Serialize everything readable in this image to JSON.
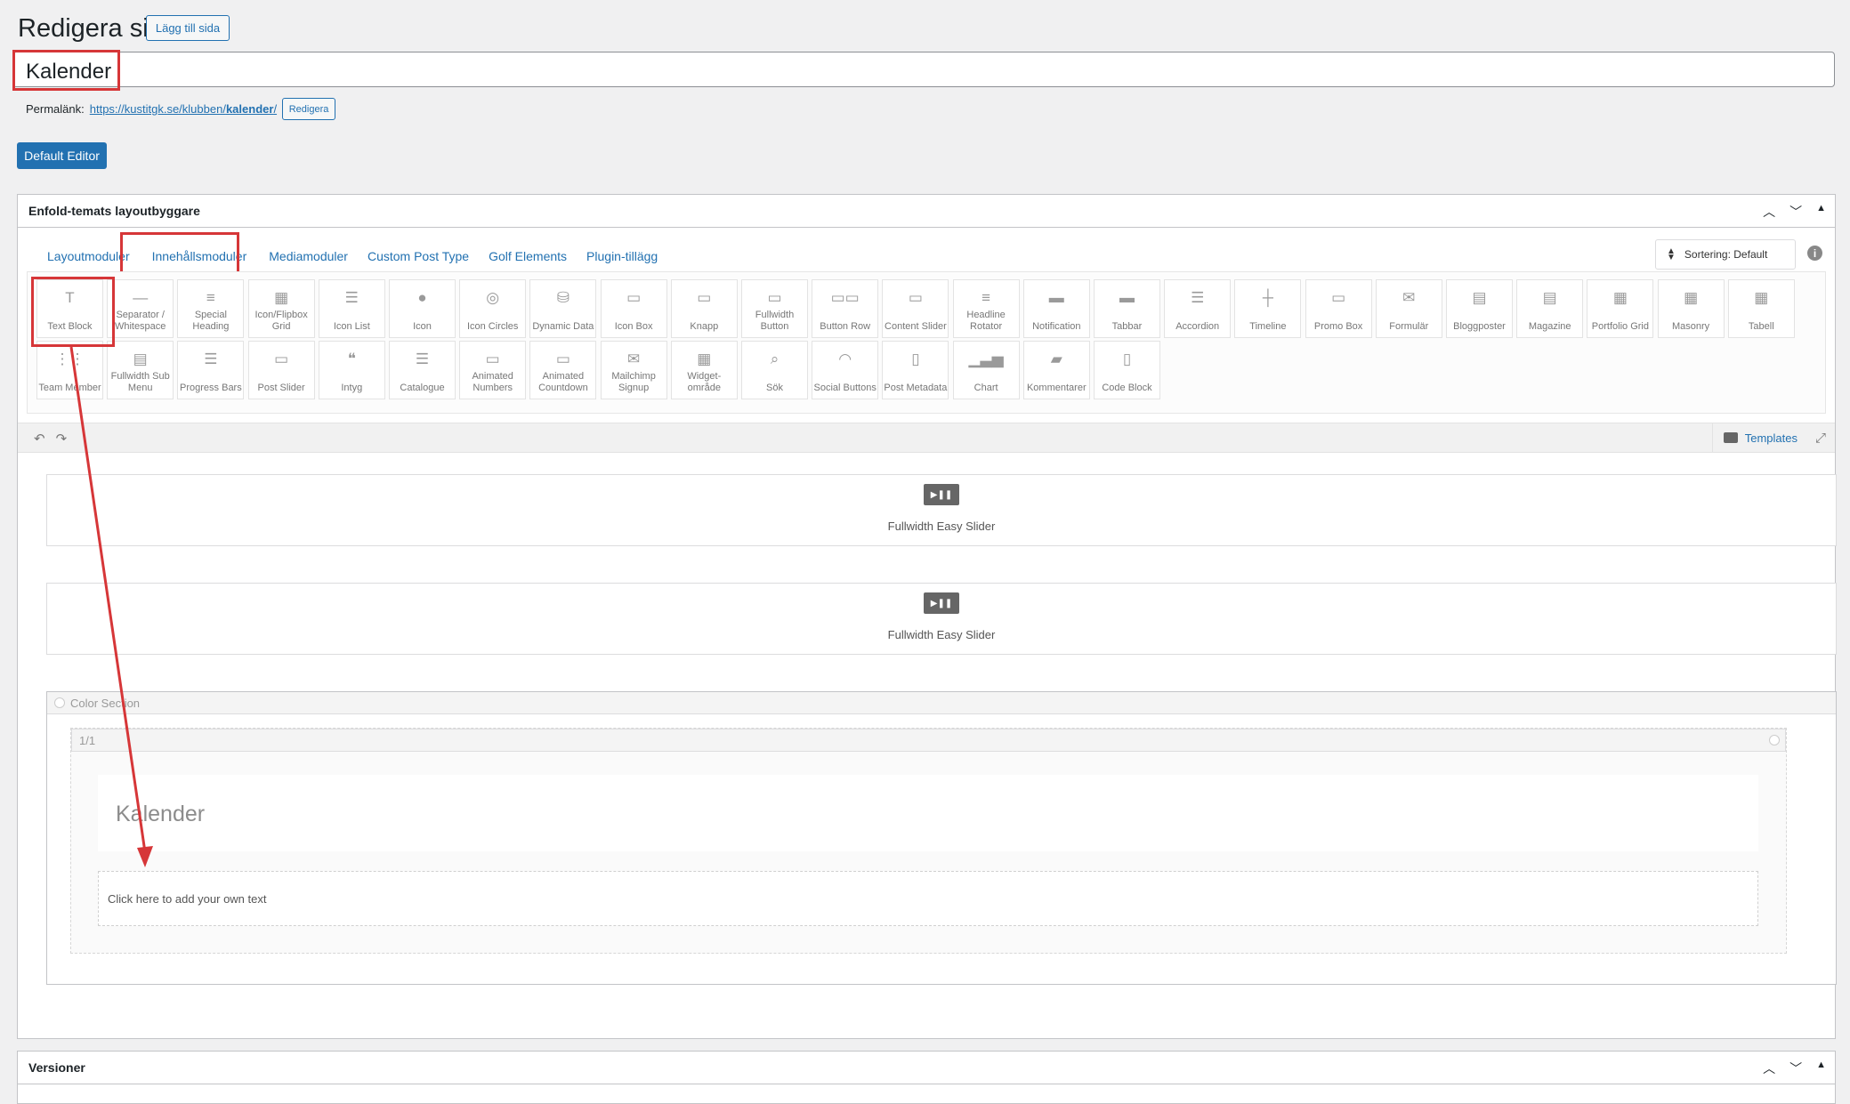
{
  "header": {
    "page_title": "Redigera sida",
    "add_page_button": "Lägg till sida",
    "post_title": "Kalender",
    "permalink_label": "Permalänk:",
    "permalink_base": "https://kustitgk.se/klubben/",
    "permalink_slug": "kalender",
    "permalink_trailing": "/",
    "edit_permalink_button": "Redigera",
    "default_editor_button": "Default Editor"
  },
  "builder": {
    "title": "Enfold-temats layoutbyggare",
    "tabs": [
      {
        "label": "Layoutmoduler"
      },
      {
        "label": "Innehållsmoduler"
      },
      {
        "label": "Mediamoduler"
      },
      {
        "label": "Custom Post Type"
      },
      {
        "label": "Golf Elements"
      },
      {
        "label": "Plugin-tillägg"
      }
    ],
    "sort_label": "Sortering: Default",
    "modules_row1": [
      {
        "label": "Text Block",
        "icon": "text-icon"
      },
      {
        "label": "Separator / Whitespace",
        "icon": "separator-icon"
      },
      {
        "label": "Special Heading",
        "icon": "heading-icon"
      },
      {
        "label": "Icon/Flipbox Grid",
        "icon": "grid-icon"
      },
      {
        "label": "Icon List",
        "icon": "list-icon"
      },
      {
        "label": "Icon",
        "icon": "info-icon"
      },
      {
        "label": "Icon Circles",
        "icon": "circles-icon"
      },
      {
        "label": "Dynamic Data",
        "icon": "database-icon"
      },
      {
        "label": "Icon Box",
        "icon": "box-icon"
      },
      {
        "label": "Knapp",
        "icon": "button-icon"
      },
      {
        "label": "Fullwidth Button",
        "icon": "button-icon"
      },
      {
        "label": "Button Row",
        "icon": "button-row-icon"
      },
      {
        "label": "Content Slider",
        "icon": "slider-icon"
      },
      {
        "label": "Headline Rotator",
        "icon": "rotator-icon"
      },
      {
        "label": "Notification",
        "icon": "notification-icon"
      },
      {
        "label": "Tabbar",
        "icon": "tabs-icon"
      },
      {
        "label": "Accordion",
        "icon": "accordion-icon"
      },
      {
        "label": "Timeline",
        "icon": "timeline-icon"
      },
      {
        "label": "Promo Box",
        "icon": "promo-icon"
      },
      {
        "label": "Formulär",
        "icon": "envelope-icon"
      },
      {
        "label": "Bloggposter",
        "icon": "blog-icon"
      },
      {
        "label": "Magazine",
        "icon": "magazine-icon"
      },
      {
        "label": "Portfolio Grid",
        "icon": "portfolio-icon"
      },
      {
        "label": "Masonry",
        "icon": "masonry-icon"
      },
      {
        "label": "Tabell",
        "icon": "table-icon"
      }
    ],
    "modules_row2": [
      {
        "label": "Team Member",
        "icon": "team-icon"
      },
      {
        "label": "Fullwidth Sub Menu",
        "icon": "menu-icon"
      },
      {
        "label": "Progress Bars",
        "icon": "progress-icon"
      },
      {
        "label": "Post Slider",
        "icon": "post-slider-icon"
      },
      {
        "label": "Intyg",
        "icon": "quote-icon"
      },
      {
        "label": "Catalogue",
        "icon": "catalogue-icon"
      },
      {
        "label": "Animated Numbers",
        "icon": "numbers-icon"
      },
      {
        "label": "Animated Countdown",
        "icon": "countdown-icon"
      },
      {
        "label": "Mailchimp Signup",
        "icon": "mail-icon"
      },
      {
        "label": "Widget-område",
        "icon": "widget-icon"
      },
      {
        "label": "Sök",
        "icon": "search-icon"
      },
      {
        "label": "Social Buttons",
        "icon": "rss-icon"
      },
      {
        "label": "Post Metadata",
        "icon": "document-icon"
      },
      {
        "label": "Chart",
        "icon": "chart-icon"
      },
      {
        "label": "Kommentarer",
        "icon": "comments-icon"
      },
      {
        "label": "Code Block",
        "icon": "code-icon"
      }
    ],
    "templates_label": "Templates",
    "canvas": {
      "slider1_label": "Fullwidth Easy Slider",
      "slider2_label": "Fullwidth Easy Slider",
      "color_section_label": "Color Section",
      "column_label": "1/1",
      "heading_text": "Kalender",
      "text_block_placeholder": "Click here to add your own text"
    }
  },
  "versions": {
    "title": "Versioner"
  },
  "colors": {
    "accent": "#2271b1",
    "highlight_red": "#d63638"
  }
}
